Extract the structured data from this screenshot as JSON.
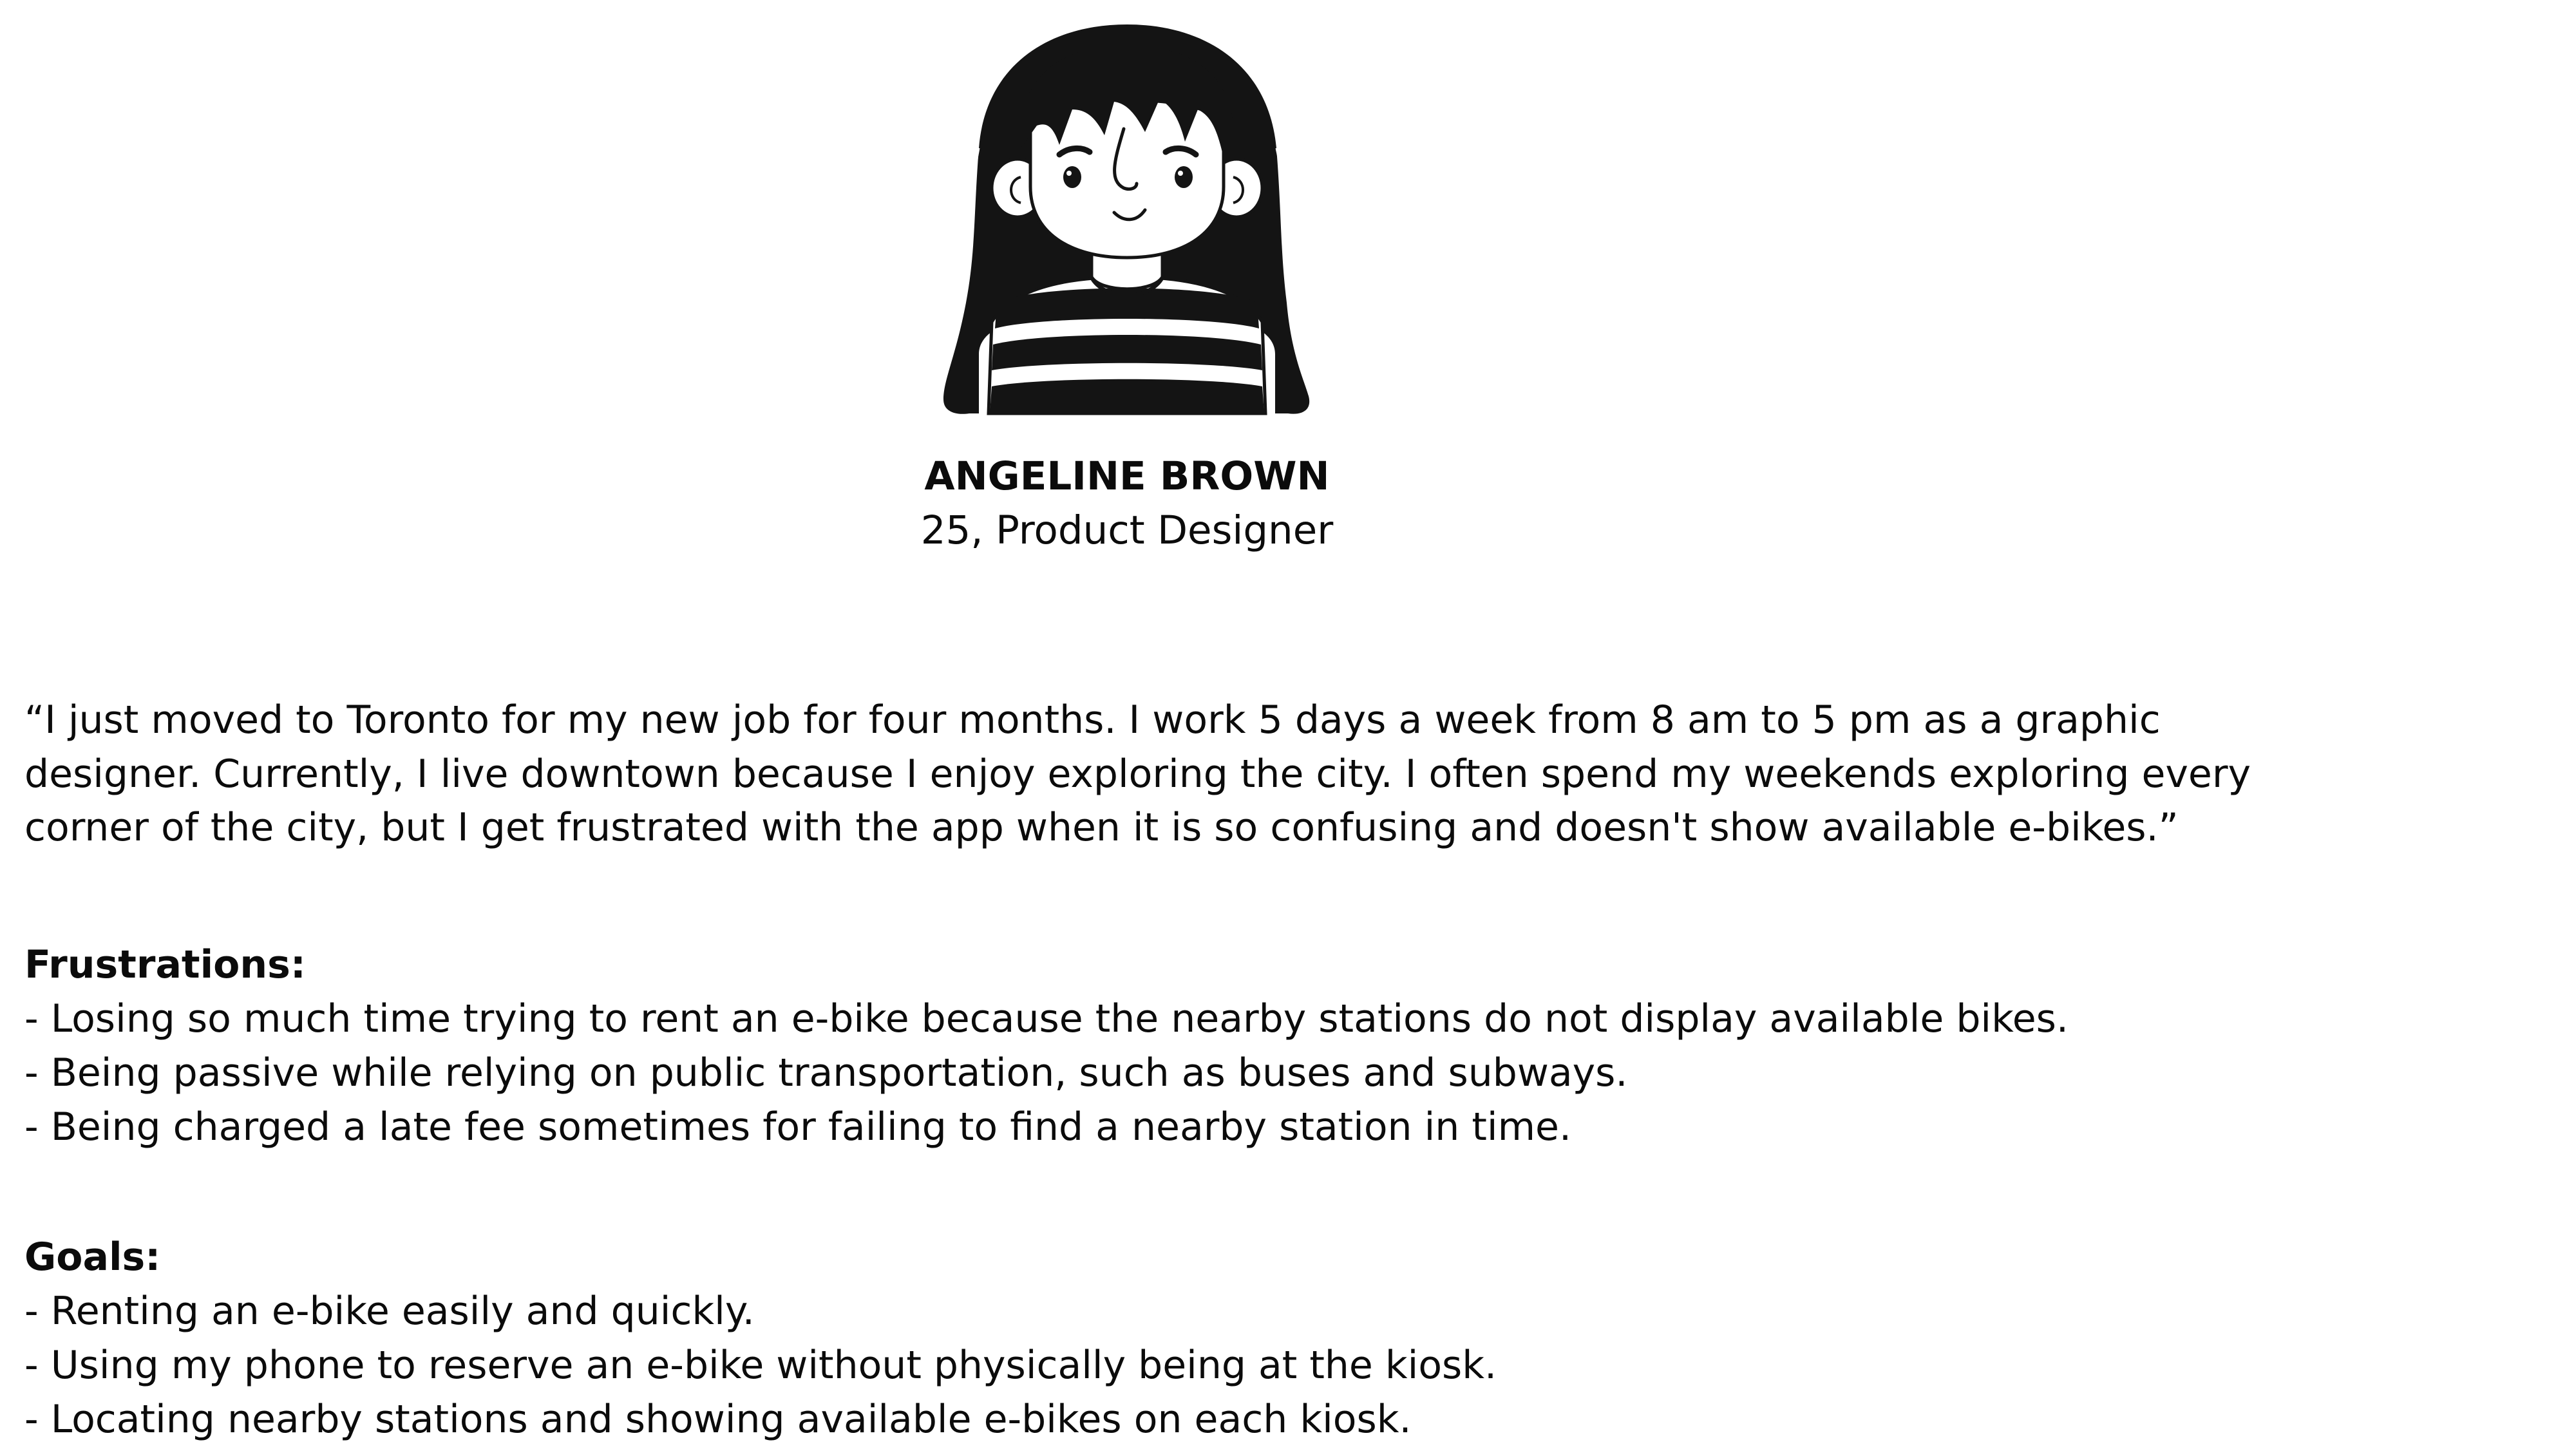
{
  "persona": {
    "avatar_icon": "cartoon-girl-avatar",
    "name": "ANGELINE BROWN",
    "subtitle": "25, Product Designer"
  },
  "quote": {
    "lines": [
      "“I just moved to Toronto for my new job for four months. I work 5 days a week from 8 am to 5 pm as a graphic",
      "designer. Currently, I live downtown because I enjoy exploring the city. I often spend my weekends exploring every",
      "corner of the city, but I get frustrated with the app when it is so confusing and doesn't show available e-bikes.”"
    ]
  },
  "frustrations": {
    "heading": "Frustrations:",
    "items": [
      "- Losing so much time trying to rent an e-bike because the nearby stations do not display available bikes.",
      "- Being passive while relying on public transportation, such as buses and subways.",
      "- Being charged a late fee sometimes for failing to find a nearby station in time."
    ]
  },
  "goals": {
    "heading": "Goals:",
    "items": [
      "- Renting an e-bike easily and quickly.",
      "- Using my phone to reserve an e-bike without physically being at the kiosk.",
      "- Locating nearby stations and showing available e-bikes on each kiosk."
    ]
  }
}
